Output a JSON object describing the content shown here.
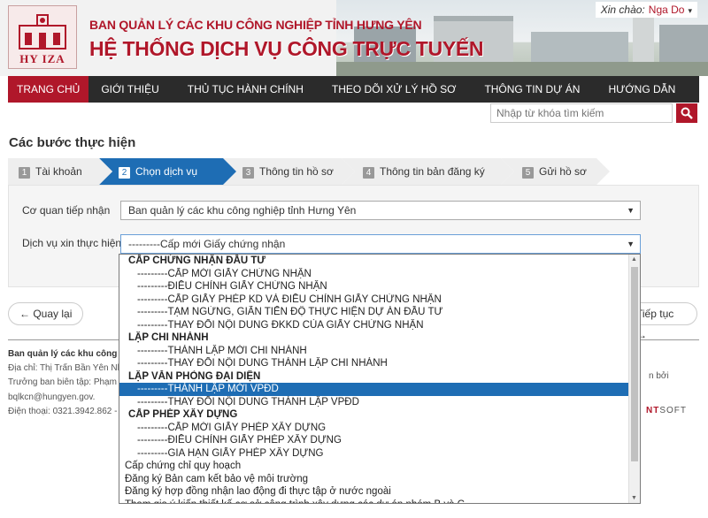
{
  "header": {
    "logo_text": "HY IZA",
    "org_name": "BAN QUẢN LÝ CÁC KHU CÔNG NGHIỆP TỈNH HƯNG YÊN",
    "system_name": "HỆ THỐNG DỊCH VỤ CÔNG TRỰC TUYẾN",
    "greeting": "Xin chào:",
    "user_name": "Nga Do",
    "caret": "▾"
  },
  "nav": {
    "items": [
      {
        "label": "TRANG CHỦ",
        "active": true
      },
      {
        "label": "GIỚI THIỆU",
        "active": false
      },
      {
        "label": "THỦ TỤC HÀNH CHÍNH",
        "active": false
      },
      {
        "label": "THEO DÕI XỬ LÝ HỒ SƠ",
        "active": false
      },
      {
        "label": "THÔNG TIN DỰ ÁN",
        "active": false
      },
      {
        "label": "HƯỚNG DẪN",
        "active": false
      }
    ]
  },
  "search": {
    "placeholder": "Nhập từ khóa tìm kiếm"
  },
  "steps": {
    "title": "Các bước thực hiện",
    "items": [
      {
        "num": "1",
        "label": "Tài khoản"
      },
      {
        "num": "2",
        "label": "Chọn dịch vụ"
      },
      {
        "num": "3",
        "label": "Thông tin hồ sơ"
      },
      {
        "num": "4",
        "label": "Thông tin bản đăng ký"
      },
      {
        "num": "5",
        "label": "Gửi hồ sơ"
      }
    ],
    "active_index": 1
  },
  "form": {
    "agency_label": "Cơ quan tiếp nhận",
    "agency_value": "Ban quản lý các khu công nghiệp tỉnh Hưng Yên",
    "service_label": "Dịch vụ xin thực hiện",
    "service_value": "---------Cấp mới Giấy chứng nhận",
    "arrow": "▼"
  },
  "buttons": {
    "back": "← Quay lại",
    "next": "Tiếp tục →"
  },
  "footer": {
    "org": "Ban quản lý các khu công",
    "address": "Địa chỉ: Thị Trấn Bần Yên Nhâ",
    "editor": "Trưởng ban biên tập: Phạm T",
    "email": "bqlkcn@hungyen.gov.",
    "phone": "Điện thoại: 0321.3942.862 -",
    "credit": "n bởi",
    "brand_prefix": "NT",
    "brand_suffix": "SOFT"
  },
  "dropdown": {
    "items": [
      {
        "text": "CẤP CHỨNG NHẬN ĐẦU TƯ",
        "kind": "group"
      },
      {
        "text": "---------CẤP MỚI GIẤY CHỨNG NHẬN",
        "kind": "sub"
      },
      {
        "text": "---------ĐIỀU CHỈNH GIẤY CHỨNG NHẬN",
        "kind": "sub"
      },
      {
        "text": "---------CẤP GIẤY PHÉP KD VÀ ĐIỀU CHỈNH GIẤY CHỨNG NHẬN",
        "kind": "sub"
      },
      {
        "text": "---------TẠM NGỪNG, GIÃN TIẾN ĐỘ THỰC HIỆN DỰ ÁN ĐẦU TƯ",
        "kind": "sub"
      },
      {
        "text": "---------THAY ĐỔI NỘI DUNG ĐKKD CỦA GIẤY CHỨNG NHẬN",
        "kind": "sub"
      },
      {
        "text": "LẬP CHI NHÁNH",
        "kind": "group"
      },
      {
        "text": "---------THÀNH LẬP MỚI CHI NHÁNH",
        "kind": "sub"
      },
      {
        "text": "---------THAY ĐỔI NỘI DUNG THÀNH LẬP CHI NHÁNH",
        "kind": "sub"
      },
      {
        "text": "LẬP VĂN PHÒNG ĐẠI DIỆN",
        "kind": "group"
      },
      {
        "text": "---------THÀNH LẬP MỚI VPĐD",
        "kind": "sub",
        "selected": true
      },
      {
        "text": "---------THAY ĐỔI NỘI DUNG THÀNH LẬP VPĐD",
        "kind": "sub"
      },
      {
        "text": "CẤP PHÉP XÂY DỰNG",
        "kind": "group"
      },
      {
        "text": "---------CẤP MỚI GIẤY PHÉP XÂY DỰNG",
        "kind": "sub"
      },
      {
        "text": "---------ĐIỀU CHỈNH GIẤY PHÉP XÂY DỰNG",
        "kind": "sub"
      },
      {
        "text": "---------GIA HẠN GIẤY PHÉP XÂY DỰNG",
        "kind": "sub"
      },
      {
        "text": "Cấp chứng chỉ quy hoạch",
        "kind": "plain"
      },
      {
        "text": "Đăng ký Bản cam kết bảo vệ môi trường",
        "kind": "plain"
      },
      {
        "text": "Đăng ký hợp đồng nhận lao động đi thực tập ở nước ngoài",
        "kind": "plain"
      },
      {
        "text": "Tham gia ý kiến thiết kế cơ sở công trình xây dựng các dự án nhóm B và C",
        "kind": "plain"
      }
    ]
  },
  "colors": {
    "brand_red": "#b0172a",
    "active_blue": "#1e6db4",
    "nav_dark": "#2b2b2b"
  }
}
